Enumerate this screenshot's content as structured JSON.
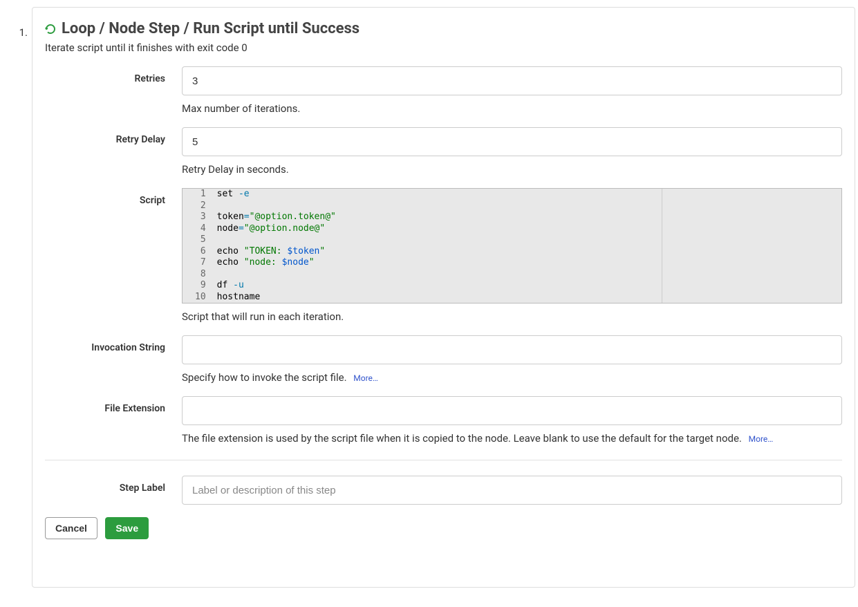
{
  "step_number": "1.",
  "header": {
    "title": "Loop / Node Step / Run Script until Success",
    "subtitle": "Iterate script until it finishes with exit code 0"
  },
  "fields": {
    "retries": {
      "label": "Retries",
      "value": "3",
      "help": "Max number of iterations."
    },
    "retry_delay": {
      "label": "Retry Delay",
      "value": "5",
      "help": "Retry Delay in seconds."
    },
    "script": {
      "label": "Script",
      "lines": [
        [
          {
            "t": "id",
            "v": "set"
          },
          {
            "t": "plain",
            "v": " "
          },
          {
            "t": "kw",
            "v": "-e"
          }
        ],
        [],
        [
          {
            "t": "id",
            "v": "token"
          },
          {
            "t": "kw",
            "v": "="
          },
          {
            "t": "str",
            "v": "\"@option.token@\""
          }
        ],
        [
          {
            "t": "id",
            "v": "node"
          },
          {
            "t": "kw",
            "v": "="
          },
          {
            "t": "str",
            "v": "\"@option.node@\""
          }
        ],
        [],
        [
          {
            "t": "id",
            "v": "echo"
          },
          {
            "t": "plain",
            "v": " "
          },
          {
            "t": "str",
            "v": "\"TOKEN: "
          },
          {
            "t": "var",
            "v": "$token"
          },
          {
            "t": "str",
            "v": "\""
          }
        ],
        [
          {
            "t": "id",
            "v": "echo"
          },
          {
            "t": "plain",
            "v": " "
          },
          {
            "t": "str",
            "v": "\"node: "
          },
          {
            "t": "var",
            "v": "$node"
          },
          {
            "t": "str",
            "v": "\""
          }
        ],
        [],
        [
          {
            "t": "id",
            "v": "df"
          },
          {
            "t": "plain",
            "v": " "
          },
          {
            "t": "kw",
            "v": "-u"
          }
        ],
        [
          {
            "t": "id",
            "v": "hostname"
          }
        ]
      ],
      "help": "Script that will run in each iteration."
    },
    "invocation": {
      "label": "Invocation String",
      "value": "",
      "help": "Specify how to invoke the script file.",
      "more": "More…"
    },
    "file_ext": {
      "label": "File Extension",
      "value": "",
      "help": "The file extension is used by the script file when it is copied to the node. Leave blank to use the default for the target node.",
      "more": "More…"
    },
    "step_label": {
      "label": "Step Label",
      "placeholder": "Label or description of this step",
      "value": ""
    }
  },
  "actions": {
    "cancel": "Cancel",
    "save": "Save"
  }
}
